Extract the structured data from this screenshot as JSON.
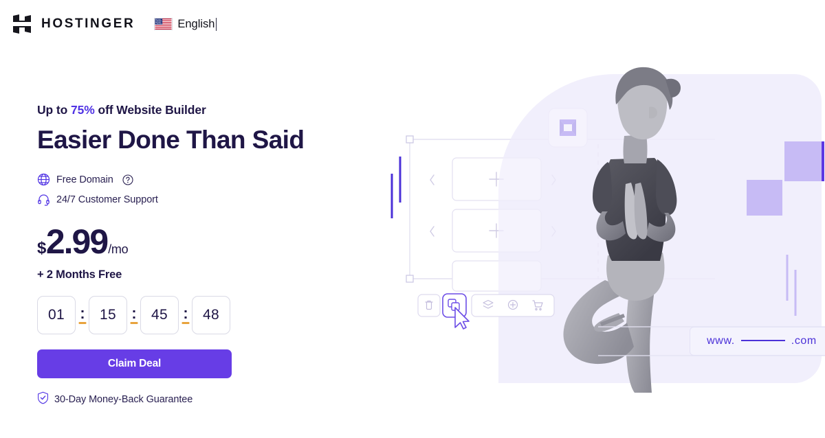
{
  "header": {
    "brand_name": "HOSTINGER",
    "logo_icon": "hostinger-h-logo",
    "language": {
      "label": "English",
      "flag_icon": "us-flag-icon"
    }
  },
  "hero": {
    "eyebrow_prefix": "Up to ",
    "eyebrow_highlight": "75%",
    "eyebrow_suffix": " off Website Builder",
    "headline": "Easier Done Than Said",
    "features": [
      {
        "icon": "globe-icon",
        "label": "Free Domain",
        "has_help": true,
        "help_icon": "question-circle-icon"
      },
      {
        "icon": "headset-icon",
        "label": "24/7 Customer Support",
        "has_help": false
      }
    ],
    "price": {
      "currency": "$",
      "amount": "2.99",
      "period": "/mo"
    },
    "bonus": "+ 2 Months Free",
    "countdown": {
      "separator": ":",
      "units": [
        {
          "value": "01"
        },
        {
          "value": "15"
        },
        {
          "value": "45"
        },
        {
          "value": "48"
        }
      ]
    },
    "cta_label": "Claim Deal",
    "guarantee": {
      "icon": "shield-check-icon",
      "label": "30-Day Money-Back Guarantee"
    }
  },
  "illustration": {
    "badge_icon": "hostinger-cube-icon",
    "placeholder_icon": "plus-icon",
    "arrow_prev_icon": "chevron-left-icon",
    "arrow_next_icon": "chevron-right-icon",
    "cursor_icon": "mouse-pointer-icon",
    "toolbar": [
      {
        "icon": "trash-icon",
        "active": false
      },
      {
        "icon": "duplicate-icon",
        "active": true
      },
      {
        "icon": "layers-icon",
        "active": false
      },
      {
        "icon": "plus-circle-icon",
        "active": false
      },
      {
        "icon": "cart-icon",
        "active": false
      }
    ],
    "photo_alt": "woman-yoga-tree-pose",
    "domain_bar": {
      "prefix": "www.",
      "suffix": ".com"
    }
  },
  "colors": {
    "accent_purple": "#673de6",
    "link_purple": "#5033e4",
    "headline_navy": "#1f1646",
    "separator_amber": "#e8a33d",
    "art_lavender": "#f1effc"
  }
}
